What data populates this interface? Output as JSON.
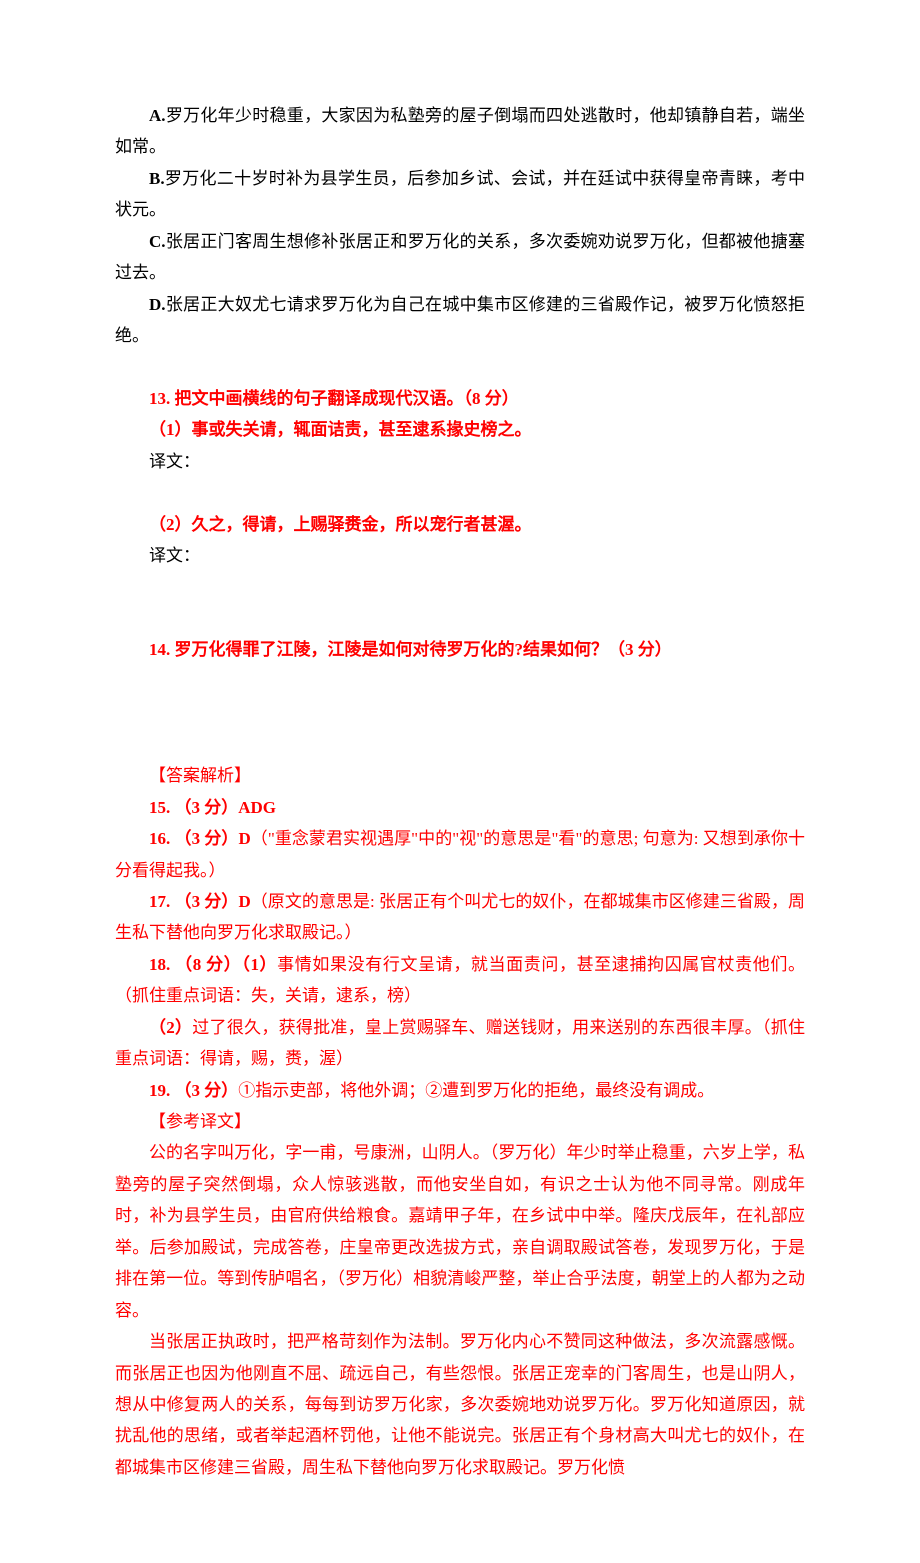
{
  "optA": "A.罗万化年少时稳重，大家因为私塾旁的屋子倒塌而四处逃散时，他却镇静自若，端坐如常。",
  "optB": "B.罗万化二十岁时补为县学生员，后参加乡试、会试，并在廷试中获得皇帝青睐，考中状元。",
  "optC": "C.张居正门客周生想修补张居正和罗万化的关系，多次委婉劝说罗万化，但都被他搪塞过去。",
  "optD": "D.张居正大奴尤七请求罗万化为自己在城中集市区修建的三省殿作记，被罗万化愤怒拒绝。",
  "q13": {
    "title": "13.  把文中画横线的句子翻译成现代汉语。（8 分）"
  },
  "q13_1": "（1）事或失关请，辄面诘责，甚至逮系掾史榜之。",
  "trans_label1": "译文：",
  "q13_2": "（2）久之，得请，上赐驿赉金，所以宠行者甚渥。",
  "trans_label2": "译文：",
  "q14": "14.  罗万化得罪了江陵，江陵是如何对待罗万化的?结果如何？（3 分）",
  "ans_head": "【答案解析】",
  "a15": "15. （3 分）ADG",
  "a16_prefix": "16. （3 分）D",
  "a16_body": "（\"重念蒙君实视遇厚\"中的\"视\"的意思是\"看\"的意思; 句意为: 又想到承你十分看得起我。）",
  "a17_prefix": "17. （3 分）D",
  "a17_body": "（原文的意思是: 张居正有个叫尤七的奴仆，在都城集市区修建三省殿，周生私下替他向罗万化求取殿记。）",
  "a18_prefix": "18. （8 分）（1）",
  "a18_body1": "事情如果没有行文呈请，就当面责问，甚至逮捕拘囚属官杖责他们。（抓住重点词语：失，关请，逮系，榜）",
  "a18_2_prefix": "（2）",
  "a18_body2": "过了很久，获得批准，皇上赏赐驿车、赠送钱财，用来送别的东西很丰厚。（抓住重点词语：得请，赐，赉，渥）",
  "a19_prefix": "19. （3 分）",
  "a19_body": "①指示吏部，将他外调；②遭到罗万化的拒绝，最终没有调成。",
  "ref_head": "【参考译文】",
  "ref_p1": "公的名字叫万化，字一甫，号康洲，山阴人。（罗万化）年少时举止稳重，六岁上学，私塾旁的屋子突然倒塌，众人惊骇逃散，而他安坐自如，有识之士认为他不同寻常。刚成年时，补为县学生员，由官府供给粮食。嘉靖甲子年，在乡试中中举。隆庆戊辰年，在礼部应举。后参加殿试，完成答卷，庄皇帝更改选拔方式，亲自调取殿试答卷，发现罗万化，于是排在第一位。等到传胪唱名，（罗万化）相貌清峻严整，举止合乎法度，朝堂上的人都为之动容。",
  "ref_p2": "当张居正执政时，把严格苛刻作为法制。罗万化内心不赞同这种做法，多次流露感慨。而张居正也因为他刚直不屈、疏远自己，有些怨恨。张居正宠幸的门客周生，也是山阴人，想从中修复两人的关系，每每到访罗万化家，多次委婉地劝说罗万化。罗万化知道原因，就扰乱他的思绪，或者举起酒杯罚他，让他不能说完。张居正有个身材高大叫尤七的奴仆，在都城集市区修建三省殿，周生私下替他向罗万化求取殿记。罗万化愤"
}
